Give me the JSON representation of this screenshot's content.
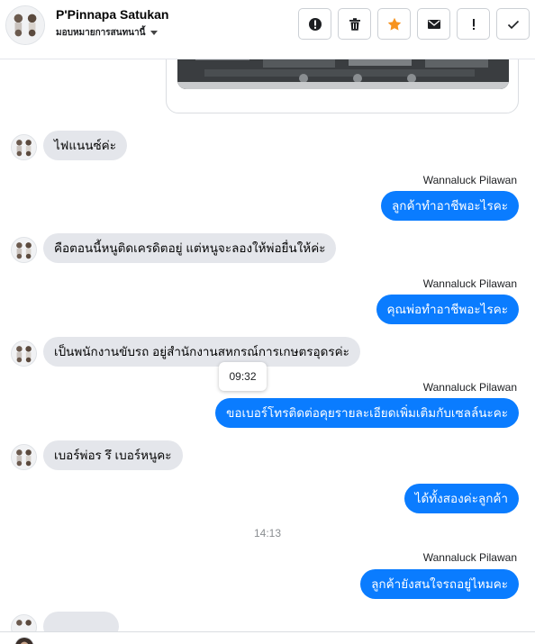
{
  "header": {
    "name": "P'Pinnapa Satukan",
    "subtitle": "มอบหมายการสนทนานี้",
    "tools": [
      {
        "icon": "alert-circle-icon",
        "name": "spam-button"
      },
      {
        "icon": "trash-icon",
        "name": "delete-button"
      },
      {
        "icon": "star-icon",
        "name": "star-button",
        "color": "#f7931e"
      },
      {
        "icon": "envelope-icon",
        "name": "mark-unread-button"
      },
      {
        "icon": "exclamation-icon",
        "name": "follow-up-button"
      },
      {
        "icon": "check-icon",
        "name": "done-button"
      }
    ]
  },
  "messages": [
    {
      "dir": "in",
      "text": "ไฟแนนซ์ค่ะ"
    },
    {
      "dir": "out",
      "sender": "Wannaluck Pilawan",
      "text": "ลูกค้าทำอาชีพอะไรคะ"
    },
    {
      "dir": "in",
      "text": "คือตอนนี้หนูติดเครดิตอยู่ แต่หนูจะลองให้พ่อยื่นให้ค่ะ"
    },
    {
      "dir": "out",
      "sender": "Wannaluck Pilawan",
      "text": "คุณพ่อทำอาชีพอะไรคะ"
    },
    {
      "dir": "in",
      "text": "เป็นพนักงานขับรถ อยู่สำนักงานสหกรณ์การเกษตรอุดรค่ะ"
    },
    {
      "dir": "out",
      "sender": "Wannaluck Pilawan",
      "text": "ขอเบอร์โทรติดต่อคุยรายละเอียดเพิ่มเติมกับเซลล์นะคะ"
    },
    {
      "dir": "in",
      "text": "เบอร์พ่อร รึ เบอร์หนูคะ"
    },
    {
      "dir": "out",
      "text": "ได้ทั้งสองค่ะลูกค้า"
    },
    {
      "dir": "out",
      "sender": "Wannaluck Pilawan",
      "text": "ลูกค้ายังสนใจรถอยู่ไหมคะ"
    }
  ],
  "tooltip": "09:32",
  "timestamp": "14:13",
  "colors": {
    "outgoing": "#0a7cff",
    "incoming": "#e4e6eb",
    "star": "#f7931e"
  }
}
